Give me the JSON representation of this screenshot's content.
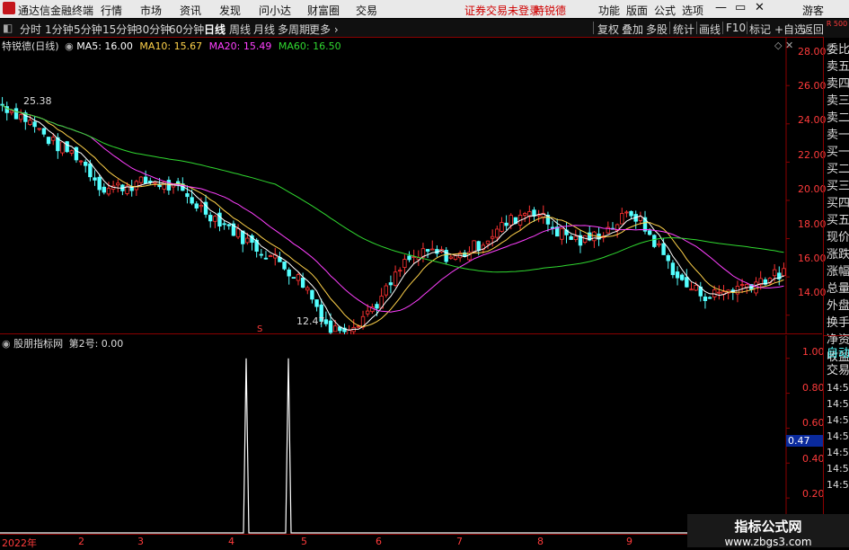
{
  "menubar": {
    "app_title": "通达信金融终端",
    "menus": [
      "行情",
      "市场",
      "资讯",
      "发现",
      "问小达",
      "财富圈",
      "交易"
    ],
    "notice": "证券交易未登录",
    "stock": "特锐德",
    "right_menus": [
      "功能",
      "版面",
      "公式",
      "选项"
    ],
    "guest": "游客"
  },
  "toolbar": {
    "periods": [
      "分时",
      "1分钟",
      "5分钟",
      "15分钟",
      "30分钟",
      "60分钟",
      "日线",
      "周线",
      "月线",
      "多周期",
      "更多 ›"
    ],
    "active": "日线",
    "right_buttons": [
      "复权",
      "叠加",
      "多股",
      "统计",
      "画线",
      "F10",
      "标记",
      "+自选",
      "返回"
    ]
  },
  "right_panel": {
    "corner": "R 500",
    "labels": [
      "委比",
      "卖五",
      "卖四",
      "卖三",
      "卖二",
      "卖一",
      "买一",
      "买二",
      "买三",
      "买四",
      "买五",
      "现价",
      "涨跌",
      "涨幅",
      "总量",
      "外盘",
      "换手",
      "净资",
      "收益"
    ],
    "lower_labels": [
      "自动",
      "交易"
    ],
    "times": [
      "14:56",
      "14:56",
      "14:56",
      "14:56",
      "14:56",
      "14:56",
      "14:56"
    ]
  },
  "indicators": {
    "ma_title": "特锐德(日线)",
    "ma5": "MA5: 16.00",
    "ma10": "MA10: 15.67",
    "ma20": "MA20: 15.49",
    "ma60": "MA60: 16.50",
    "sub_title": "股朋指标网",
    "sub_value": "第2号: 0.00",
    "high_mark": "25.38",
    "low_mark": "12.47",
    "current_value": "0.47",
    "marker_s": "S"
  },
  "price_axis": [
    "28.00",
    "26.00",
    "24.00",
    "22.00",
    "20.00",
    "18.00",
    "16.00",
    "14.00"
  ],
  "sub_axis": [
    "1.00",
    "0.80",
    "0.60",
    "0.40",
    "0.20"
  ],
  "time_axis": [
    "2022年",
    "2",
    "3",
    "4",
    "5",
    "6",
    "7",
    "8",
    "9"
  ],
  "watermark": {
    "title": "指标公式网",
    "url": "www.zbgs3.com"
  },
  "colors": {
    "up": "#ff3232",
    "down": "#54ffff",
    "ma5": "#ffffff",
    "ma10": "#ffd24a",
    "ma20": "#ff40ff",
    "ma60": "#30d830",
    "grid": "#8b0000"
  },
  "chart_data": [
    {
      "type": "candlestick",
      "title": "特锐德(日线)",
      "ylim": [
        13,
        28.5
      ],
      "yticks": [
        14,
        16,
        18,
        20,
        22,
        24,
        26,
        28
      ],
      "x_months": [
        "2022年",
        "2",
        "3",
        "4",
        "5",
        "6",
        "7",
        "8",
        "9"
      ],
      "annotations": [
        {
          "label": "25.38",
          "kind": "high"
        },
        {
          "label": "12.47",
          "kind": "low"
        }
      ],
      "series": [
        {
          "name": "MA5",
          "last": 16.0
        },
        {
          "name": "MA10",
          "last": 15.67
        },
        {
          "name": "MA20",
          "last": 15.49
        },
        {
          "name": "MA60",
          "last": 16.5
        }
      ],
      "close_trend": [
        25.0,
        24.2,
        23.0,
        22.3,
        20.6,
        20.8,
        21.0,
        20.5,
        19.5,
        18.6,
        17.6,
        16.8,
        15.6,
        13.2,
        13.6,
        14.8,
        16.8,
        17.3,
        17.0,
        17.8,
        18.8,
        19.6,
        18.4,
        17.8,
        18.5,
        19.4,
        17.6,
        15.6,
        15.0,
        15.4,
        15.8,
        16.2
      ]
    },
    {
      "type": "line",
      "title": "股朋指标网",
      "series": [
        {
          "name": "第2号",
          "last": 0.0
        }
      ],
      "ylim": [
        0,
        1.05
      ],
      "yticks": [
        0.2,
        0.4,
        0.6,
        0.8,
        1.0
      ],
      "spikes": [
        1.0,
        1.0
      ]
    }
  ]
}
